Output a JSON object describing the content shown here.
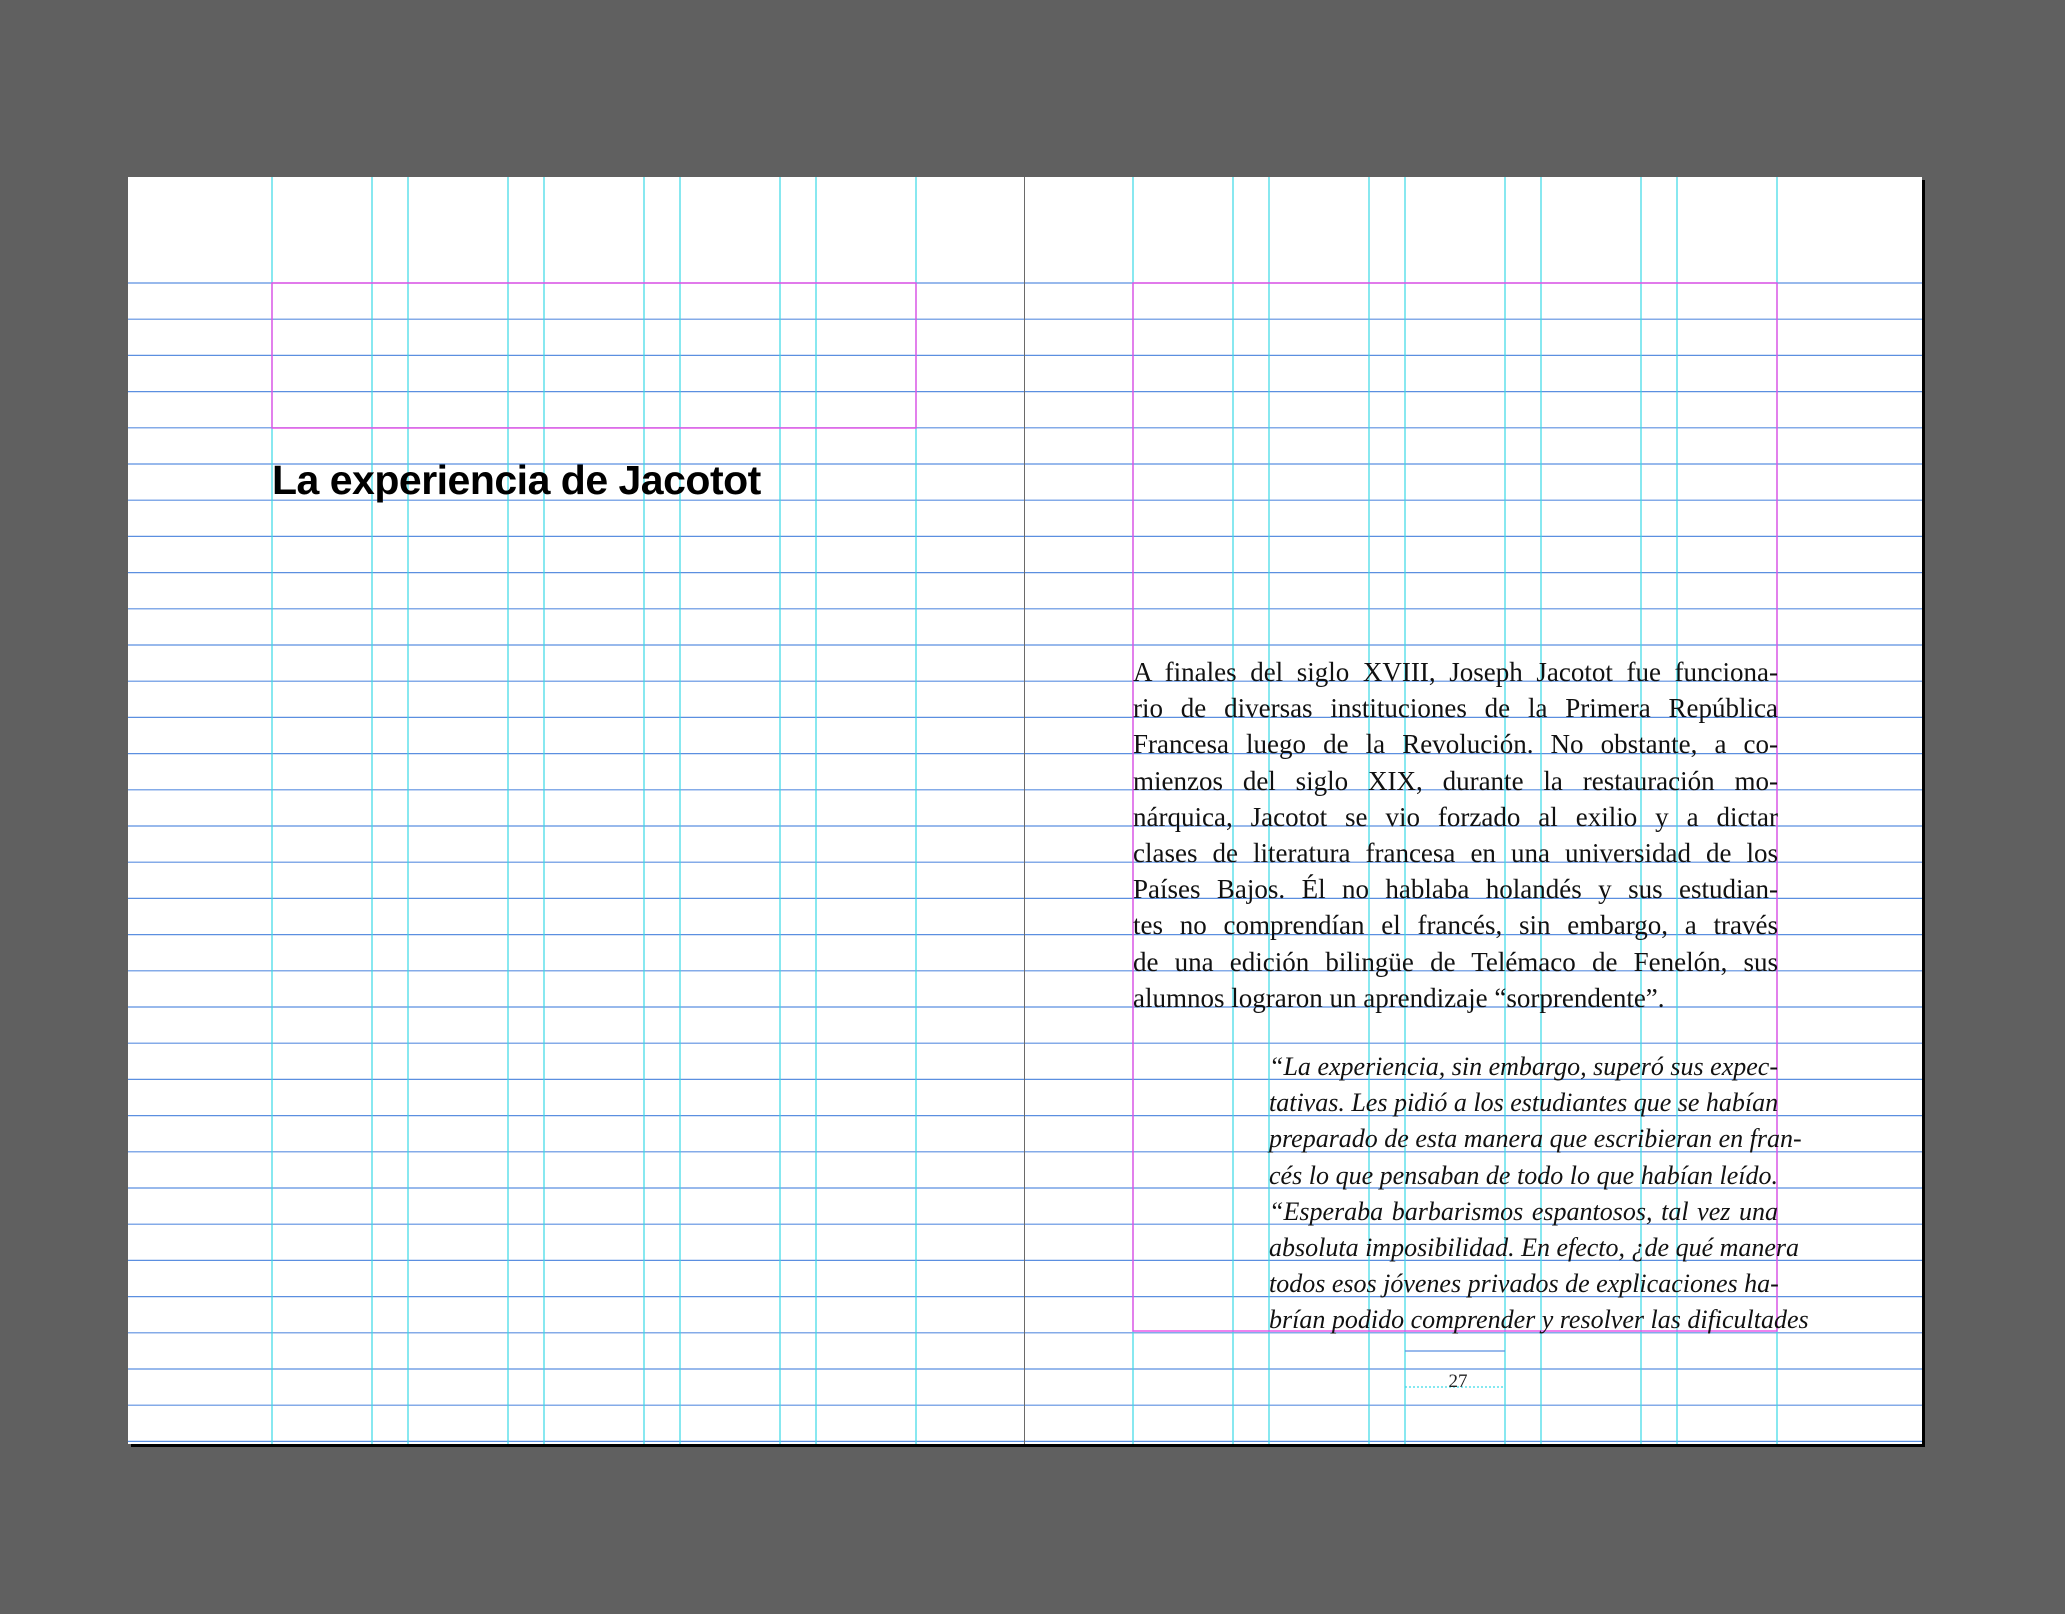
{
  "document": {
    "heading": "La experiencia de Jacotot",
    "body_lines": [
      "A finales del siglo XVIII, Joseph Jacotot fue funciona-",
      "rio de diversas instituciones de la Primera República",
      "Francesa luego de la Revolución. No obstante, a co-",
      "mienzos del siglo XIX, durante la restauración mo-",
      "nárquica, Jacotot se vio forzado al exilio y a dictar",
      "clases de literatura francesa en una universidad de los",
      "Países Bajos. Él no hablaba holandés y sus estudian-",
      "tes no comprendían el francés, sin embargo, a través",
      "de una edición bilingüe de Telémaco de Fenelón, sus",
      "alumnos lograron un aprendizaje “sorprendente”."
    ],
    "quote_lines": [
      "“La experiencia, sin embargo, superó sus expec-",
      "tativas. Les pidió a los estudiantes que se habían",
      "preparado de esta manera que escribieran en fran-",
      "cés lo que pensaban de todo lo que habían leído.",
      "“Esperaba barbarismos espantosos, tal vez una",
      "absoluta imposibilidad. En efecto, ¿de qué manera",
      "todos esos jóvenes privados de explicaciones ha-",
      "brían podido comprender y resolver las dificultades"
    ],
    "page_number": "27"
  },
  "colors": {
    "pasteboard": "#606060",
    "page": "#ffffff",
    "column_guide": "#3ad9e6",
    "baseline_guide": "#5b8fe0",
    "margin_guide": "#e64ee6",
    "spine": "#6a6a6a"
  }
}
